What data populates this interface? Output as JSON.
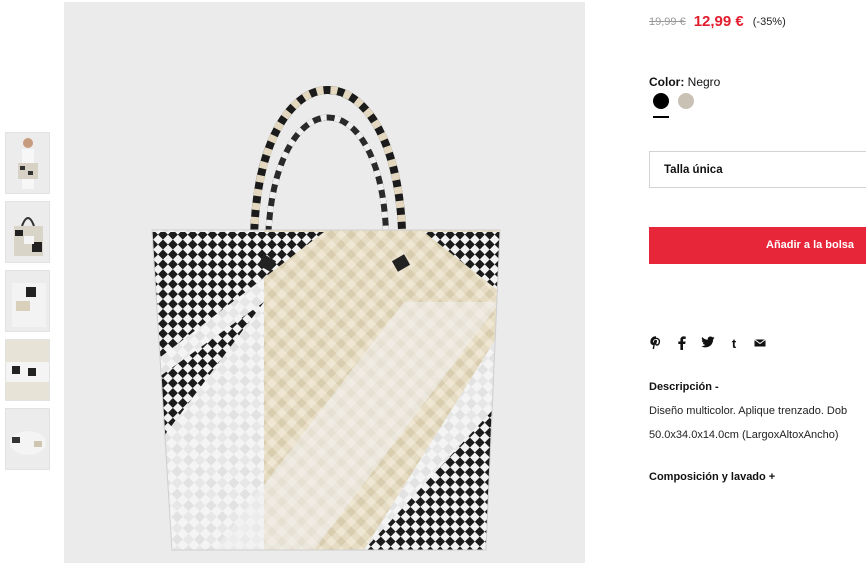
{
  "thumbnails": [
    {
      "alt": "Modelo con bolso"
    },
    {
      "alt": "Bolso frontal"
    },
    {
      "alt": "Bolso lateral"
    },
    {
      "alt": "Detalle trenzado"
    },
    {
      "alt": "Base del bolso"
    }
  ],
  "product": {
    "old_price": "19,99 €",
    "new_price": "12,99 €",
    "discount": "(-35%)",
    "color_label": "Color:",
    "color_value": "Negro",
    "size_value": "Talla única",
    "add_to_bag": "Añadir a la bolsa"
  },
  "share": [
    "pinterest-icon",
    "facebook-icon",
    "twitter-icon",
    "tumblr-icon",
    "email-icon"
  ],
  "description": {
    "title": "Descripción -",
    "text": "Diseño multicolor. Aplique trenzado. Dob",
    "dimensions": "50.0x34.0x14.0cm (LargoxAltoxAncho)"
  },
  "composition": {
    "title": "Composición y lavado +"
  },
  "colors": {
    "accent": "#e8263a",
    "price": "#e21d2e",
    "swatch_black": "#000000",
    "swatch_beige": "#c9c1b3"
  }
}
